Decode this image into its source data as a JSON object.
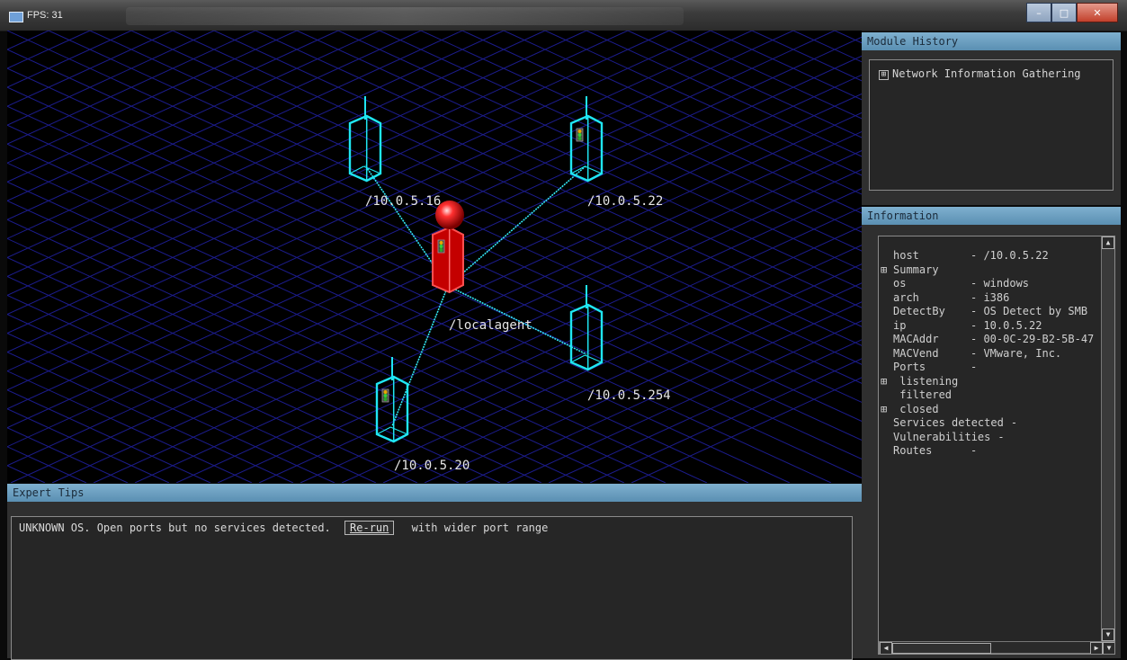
{
  "titlebar": {
    "title": "FPS: 31"
  },
  "window_buttons": {
    "minimize": "–",
    "maximize": "□",
    "close": "✕"
  },
  "network_map": {
    "nodes": [
      {
        "id": "agent",
        "label": "/localagent",
        "type": "agent",
        "color": "#ff1a1a"
      },
      {
        "id": "h16",
        "label": "/10.0.5.16",
        "type": "host",
        "color": "#1fe6f2"
      },
      {
        "id": "h22",
        "label": "/10.0.5.22",
        "type": "host",
        "color": "#1fe6f2",
        "status_light": true
      },
      {
        "id": "h254",
        "label": "/10.0.5.254",
        "type": "host",
        "color": "#1fe6f2"
      },
      {
        "id": "h20",
        "label": "/10.0.5.20",
        "type": "host",
        "color": "#1fe6f2",
        "status_light": true
      }
    ],
    "links": [
      [
        "agent",
        "h16"
      ],
      [
        "agent",
        "h22"
      ],
      [
        "agent",
        "h254"
      ],
      [
        "agent",
        "h20"
      ]
    ],
    "grid_color": "#1c1c8c"
  },
  "module_history": {
    "title": "Module History",
    "items": [
      {
        "label": "Network Information Gathering",
        "expander": "⊞"
      }
    ]
  },
  "information": {
    "title": "Information",
    "rows": [
      {
        "expander": "",
        "key": "host",
        "value": "- /10.0.5.22"
      },
      {
        "expander": "⊞",
        "key": "Summary",
        "value": ""
      },
      {
        "expander": "",
        "key": "os",
        "value": "- windows"
      },
      {
        "expander": "",
        "key": "arch",
        "value": "- i386"
      },
      {
        "expander": "",
        "key": "DetectBy",
        "value": "- OS Detect by SMB"
      },
      {
        "expander": "",
        "key": "ip",
        "value": "- 10.0.5.22"
      },
      {
        "expander": "",
        "key": "MACAddr",
        "value": "- 00-0C-29-B2-5B-47"
      },
      {
        "expander": "",
        "key": "MACVend",
        "value": "- VMware, Inc."
      },
      {
        "expander": "",
        "key": "Ports",
        "value": "-"
      },
      {
        "expander": "⊞",
        "key": " listening",
        "value": ""
      },
      {
        "expander": "",
        "key": " filtered",
        "value": ""
      },
      {
        "expander": "⊞",
        "key": " closed",
        "value": ""
      },
      {
        "expander": "",
        "key": "Services detected",
        "value": "-"
      },
      {
        "expander": "",
        "key": "Vulnerabilities",
        "value": "-"
      },
      {
        "expander": "",
        "key": "Routes",
        "value": "-"
      }
    ]
  },
  "expert_tips": {
    "title": "Expert Tips",
    "message": "UNKNOWN OS. Open ports but no services detected.",
    "button_label": "Re-run",
    "suffix": "with wider port range"
  }
}
